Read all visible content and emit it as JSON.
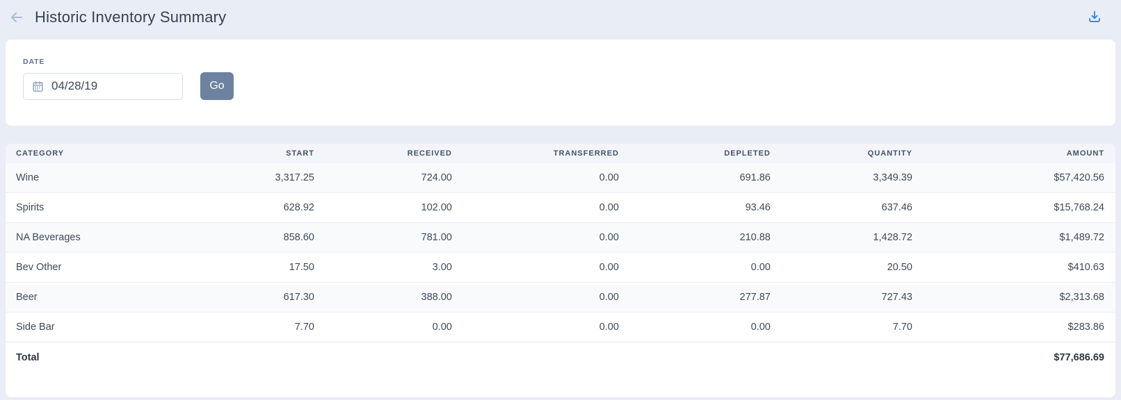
{
  "header": {
    "title": "Historic Inventory Summary",
    "icons": {
      "back": "back-arrow-icon",
      "download": "download-icon"
    }
  },
  "filter": {
    "date_label": "DATE",
    "date_value": "04/28/19",
    "calendar_icon": "calendar-icon",
    "go_label": "Go"
  },
  "table": {
    "columns": [
      "CATEGORY",
      "START",
      "RECEIVED",
      "TRANSFERRED",
      "DEPLETED",
      "QUANTITY",
      "AMOUNT"
    ],
    "rows": [
      {
        "category": "Wine",
        "start": "3,317.25",
        "received": "724.00",
        "transferred": "0.00",
        "depleted": "691.86",
        "quantity": "3,349.39",
        "amount": "$57,420.56"
      },
      {
        "category": "Spirits",
        "start": "628.92",
        "received": "102.00",
        "transferred": "0.00",
        "depleted": "93.46",
        "quantity": "637.46",
        "amount": "$15,768.24"
      },
      {
        "category": "NA Beverages",
        "start": "858.60",
        "received": "781.00",
        "transferred": "0.00",
        "depleted": "210.88",
        "quantity": "1,428.72",
        "amount": "$1,489.72"
      },
      {
        "category": "Bev Other",
        "start": "17.50",
        "received": "3.00",
        "transferred": "0.00",
        "depleted": "0.00",
        "quantity": "20.50",
        "amount": "$410.63"
      },
      {
        "category": "Beer",
        "start": "617.30",
        "received": "388.00",
        "transferred": "0.00",
        "depleted": "277.87",
        "quantity": "727.43",
        "amount": "$2,313.68"
      },
      {
        "category": "Side Bar",
        "start": "7.70",
        "received": "0.00",
        "transferred": "0.00",
        "depleted": "0.00",
        "quantity": "7.70",
        "amount": "$283.86"
      }
    ],
    "total": {
      "label": "Total",
      "amount": "$77,686.69"
    }
  },
  "colors": {
    "page_background": "#e9edf6",
    "accent_blue": "#3e7edb",
    "button_slate": "#6d81a0",
    "label_slate": "#5a7194",
    "header_text": "#42526b"
  }
}
